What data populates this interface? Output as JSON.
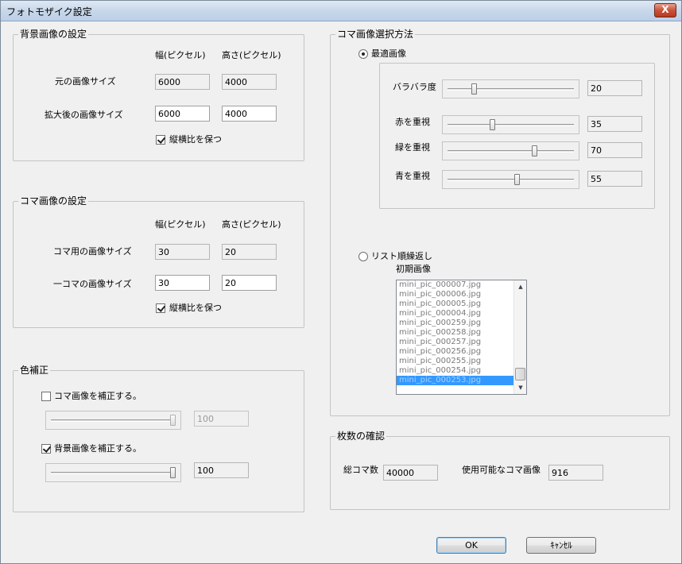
{
  "window": {
    "title": "フォトモザイク設定",
    "close_glyph": "X"
  },
  "background": {
    "group_title": "背景画像の設定",
    "col_width": "幅(ピクセル)",
    "col_height": "高さ(ピクセル)",
    "row1_label": "元の画像サイズ",
    "row1_width": "6000",
    "row1_height": "4000",
    "row2_label": "拡大後の画像サイズ",
    "row2_width": "6000",
    "row2_height": "4000",
    "keep_ratio_label": "縦横比を保つ",
    "keep_ratio_checked": true
  },
  "tile": {
    "group_title": "コマ画像の設定",
    "col_width": "幅(ピクセル)",
    "col_height": "高さ(ピクセル)",
    "row1_label": "コマ用の画像サイズ",
    "row1_width": "30",
    "row1_height": "20",
    "row2_label": "一コマの画像サイズ",
    "row2_width": "30",
    "row2_height": "20",
    "keep_ratio_label": "縦横比を保つ",
    "keep_ratio_checked": true
  },
  "color": {
    "group_title": "色補正",
    "tile_label": "コマ画像を補正する。",
    "tile_checked": false,
    "tile_value": "100",
    "tile_level": 1.0,
    "bg_label": "背景画像を補正する。",
    "bg_checked": true,
    "bg_value": "100",
    "bg_level": 1.0
  },
  "selection": {
    "group_title": "コマ画像選択方法",
    "optimal_label": "最適画像",
    "optimal_selected": true,
    "variance_label": "バラバラ度",
    "variance_value": "20",
    "variance_level": 0.2,
    "red_label": "赤を重視",
    "red_value": "35",
    "red_level": 0.35,
    "green_label": "緑を重視",
    "green_value": "70",
    "green_level": 0.7,
    "blue_label": "青を重視",
    "blue_value": "55",
    "blue_level": 0.55,
    "list_label": "リスト順繰返し",
    "list_selected": false,
    "initial_label": "初期画像",
    "files": [
      "mini_pic_000007.jpg",
      "mini_pic_000006.jpg",
      "mini_pic_000005.jpg",
      "mini_pic_000004.jpg",
      "mini_pic_000259.jpg",
      "mini_pic_000258.jpg",
      "mini_pic_000257.jpg",
      "mini_pic_000256.jpg",
      "mini_pic_000255.jpg",
      "mini_pic_000254.jpg",
      "mini_pic_000253.jpg"
    ],
    "selected_index": 10
  },
  "count": {
    "group_title": "枚数の確認",
    "total_label": "総コマ数",
    "total_value": "40000",
    "available_label": "使用可能なコマ画像",
    "available_value": "916"
  },
  "buttons": {
    "ok": "OK",
    "cancel": "ｷｬﾝｾﾙ"
  }
}
